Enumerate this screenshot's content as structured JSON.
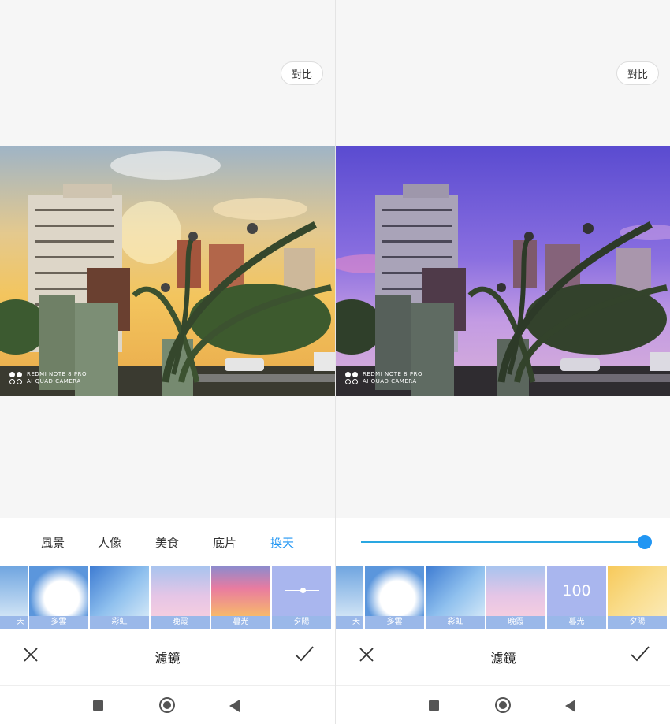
{
  "left": {
    "compare_label": "對比",
    "watermark": {
      "line1": "REDMI NOTE 8 PRO",
      "line2": "AI QUAD CAMERA"
    },
    "categories": [
      {
        "label": "風景",
        "active": false
      },
      {
        "label": "人像",
        "active": false
      },
      {
        "label": "美食",
        "active": false
      },
      {
        "label": "底片",
        "active": false
      },
      {
        "label": "換天",
        "active": true
      }
    ],
    "filters": [
      {
        "label": "天",
        "icon": "sky-thumbnail"
      },
      {
        "label": "多雲",
        "icon": "clouds-thumbnail"
      },
      {
        "label": "彩虹",
        "icon": "rainbow-thumbnail"
      },
      {
        "label": "晚霞",
        "icon": "evening-glow-thumbnail"
      },
      {
        "label": "暮光",
        "icon": "twilight-thumbnail"
      },
      {
        "label": "夕陽",
        "icon": "adjust-slider-icon",
        "selected": true
      }
    ],
    "action_title": "濾鏡"
  },
  "right": {
    "compare_label": "對比",
    "watermark": {
      "line1": "REDMI NOTE 8 PRO",
      "line2": "AI QUAD CAMERA"
    },
    "intensity": 100,
    "intensity_fraction": 1.0,
    "filters": [
      {
        "label": "天",
        "icon": "sky-thumbnail"
      },
      {
        "label": "多雲",
        "icon": "clouds-thumbnail"
      },
      {
        "label": "彩虹",
        "icon": "rainbow-thumbnail"
      },
      {
        "label": "晚霞",
        "icon": "evening-glow-thumbnail"
      },
      {
        "label": "暮光",
        "icon": "twilight-thumbnail",
        "selected": true,
        "value": "100"
      },
      {
        "label": "夕陽",
        "icon": "sunset-thumbnail"
      }
    ],
    "action_title": "濾鏡"
  },
  "colors": {
    "accent": "#2196f3",
    "slider_track": "#2aa7e1",
    "selected_thumb": "#a9b6ee"
  }
}
